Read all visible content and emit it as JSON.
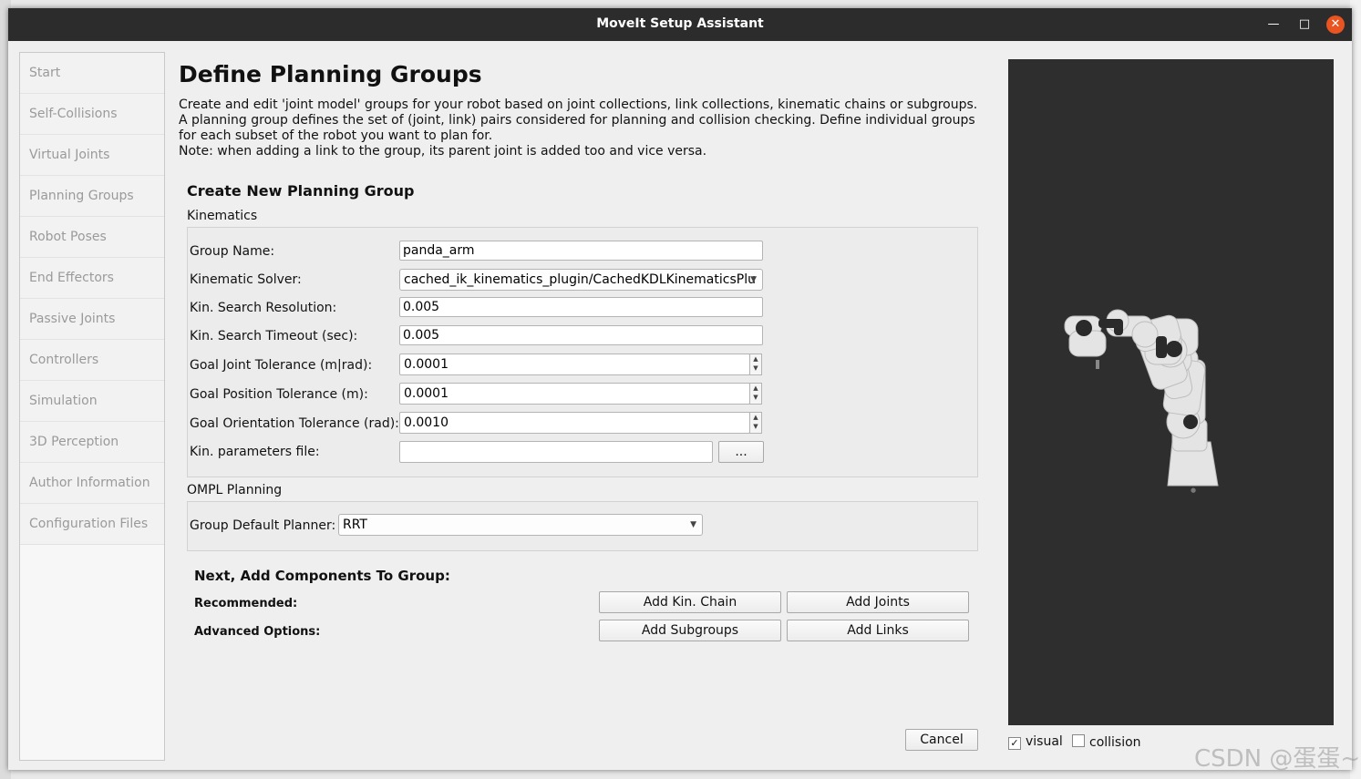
{
  "window": {
    "title": "MoveIt Setup Assistant"
  },
  "sidebar": {
    "items": [
      {
        "label": "Start"
      },
      {
        "label": "Self-Collisions"
      },
      {
        "label": "Virtual Joints"
      },
      {
        "label": "Planning Groups"
      },
      {
        "label": "Robot Poses"
      },
      {
        "label": "End Effectors"
      },
      {
        "label": "Passive Joints"
      },
      {
        "label": "Controllers"
      },
      {
        "label": "Simulation"
      },
      {
        "label": "3D Perception"
      },
      {
        "label": "Author Information"
      },
      {
        "label": "Configuration Files"
      }
    ]
  },
  "page": {
    "title": "Define Planning Groups",
    "description": "Create and edit 'joint model' groups for your robot based on joint collections, link collections, kinematic chains or subgroups. A planning group defines the set of (joint, link) pairs considered for planning and collision checking. Define individual groups for each subset of the robot you want to plan for.",
    "note": "Note: when adding a link to the group, its parent joint is added too and vice versa.",
    "section_title": "Create New Planning Group"
  },
  "kinematics": {
    "label": "Kinematics",
    "group_name_label": "Group Name:",
    "group_name_value": "panda_arm",
    "solver_label": "Kinematic Solver:",
    "solver_value": "cached_ik_kinematics_plugin/CachedKDLKinematicsPlu",
    "resolution_label": "Kin. Search Resolution:",
    "resolution_value": "0.005",
    "timeout_label": "Kin. Search Timeout (sec):",
    "timeout_value": "0.005",
    "joint_tol_label": "Goal Joint Tolerance (m|rad):",
    "joint_tol_value": "0.0001",
    "pos_tol_label": "Goal Position Tolerance (m):",
    "pos_tol_value": "0.0001",
    "orient_tol_label": "Goal Orientation Tolerance (rad):",
    "orient_tol_value": "0.0010",
    "params_file_label": "Kin. parameters file:",
    "params_file_value": "",
    "browse_label": "..."
  },
  "ompl": {
    "label": "OMPL Planning",
    "planner_label": "Group Default Planner:",
    "planner_value": "RRT"
  },
  "components": {
    "title": "Next, Add Components To Group:",
    "recommended_label": "Recommended:",
    "advanced_label": "Advanced Options:",
    "add_kin_chain": "Add Kin. Chain",
    "add_joints": "Add Joints",
    "add_subgroups": "Add Subgroups",
    "add_links": "Add Links"
  },
  "footer": {
    "cancel_label": "Cancel"
  },
  "viewer": {
    "visual_label": "visual",
    "visual_checked": true,
    "collision_label": "collision",
    "collision_checked": false
  },
  "watermark": "CSDN @蛋蛋~"
}
